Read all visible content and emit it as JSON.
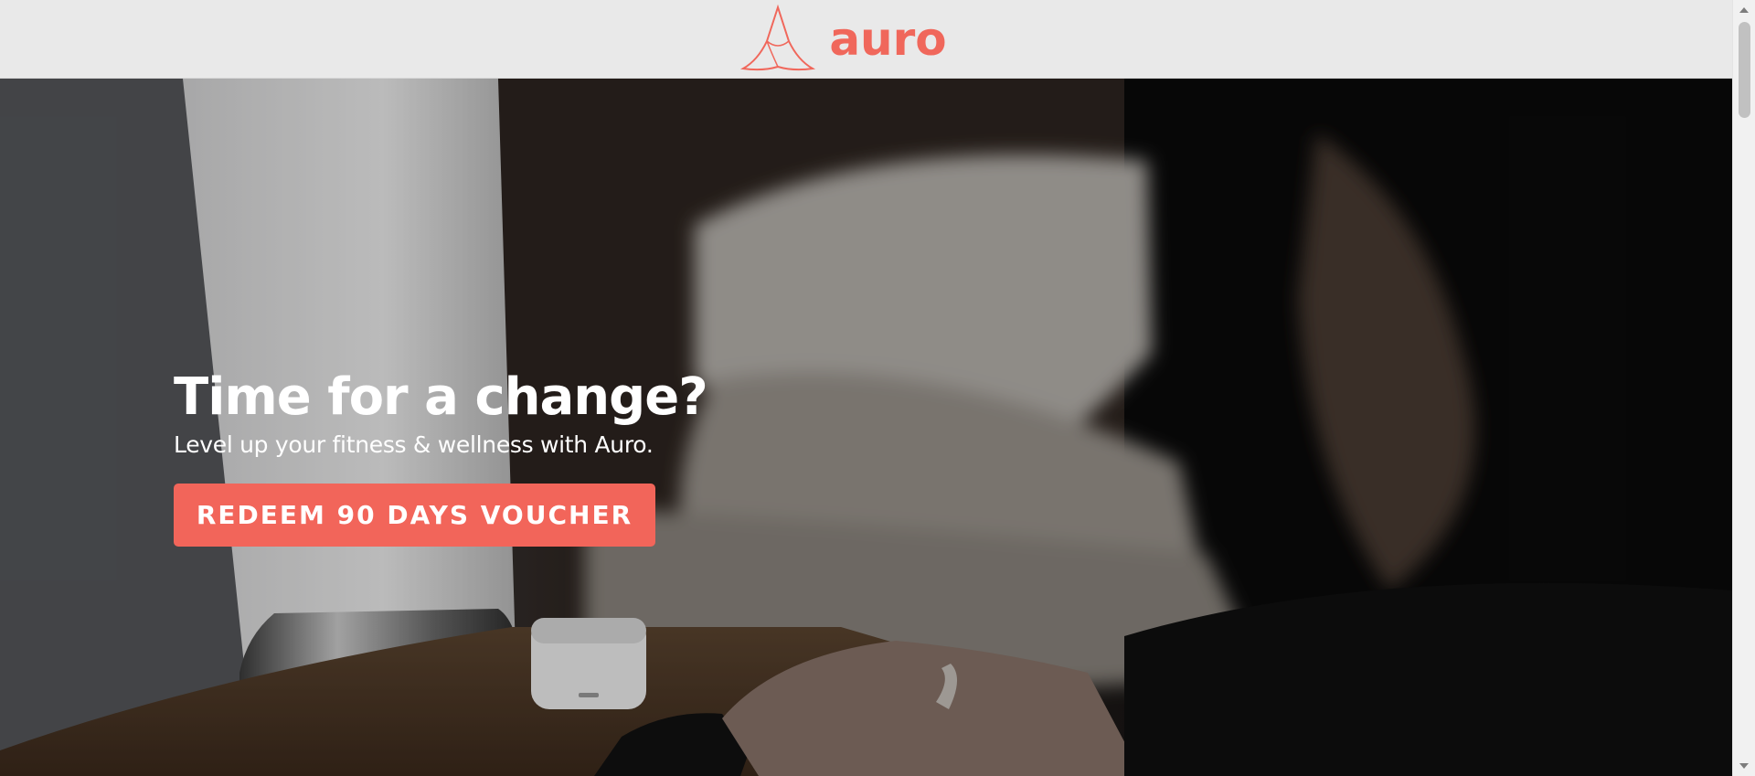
{
  "header": {
    "logo_text": "auro",
    "logo_icon": "auro-logo-icon",
    "brand_color": "#f0675b"
  },
  "hero": {
    "title": "Time for a change?",
    "subtitle": "Level up your fitness & wellness with Auro.",
    "cta_label": "REDEEM 90 DAYS VOUCHER",
    "cta_color": "#f2655a"
  },
  "scrollbar": {
    "up_icon": "chevron-up-icon",
    "down_icon": "chevron-down-icon"
  }
}
